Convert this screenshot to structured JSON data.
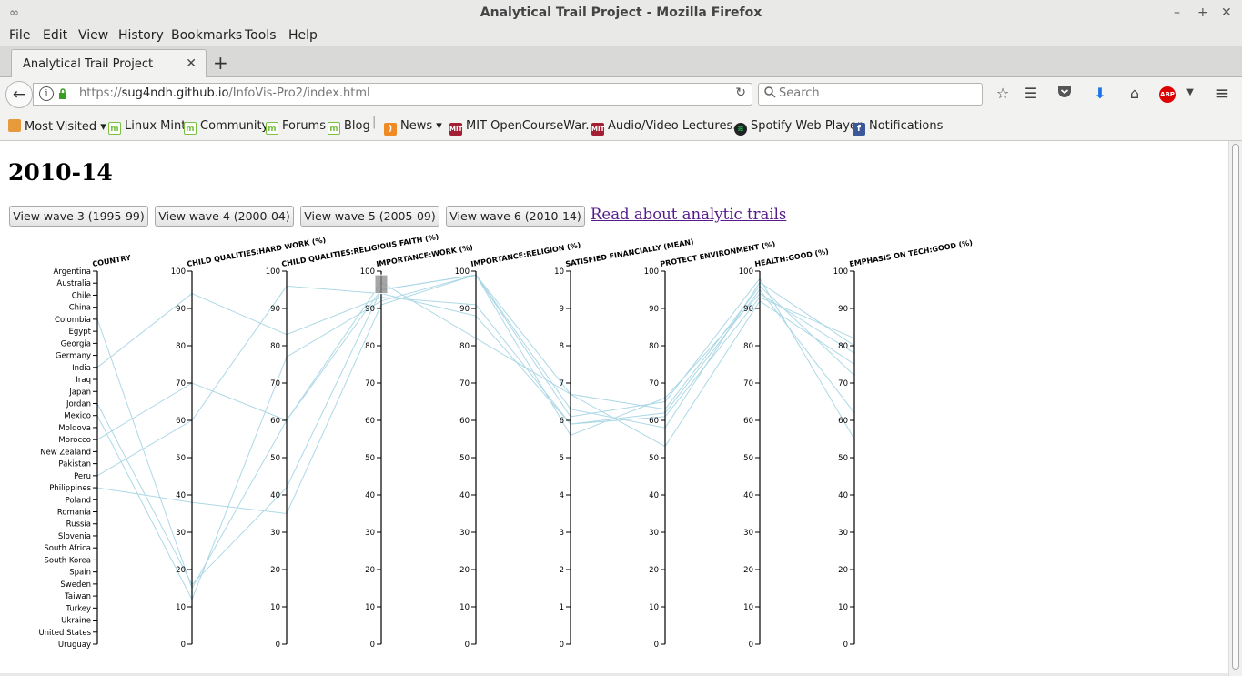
{
  "window": {
    "title": "Analytical Trail Project - Mozilla Firefox",
    "controls": [
      "–",
      "+",
      "✕"
    ]
  },
  "menu": [
    "File",
    "Edit",
    "View",
    "History",
    "Bookmarks",
    "Tools",
    "Help"
  ],
  "tab": {
    "label": "Analytical Trail Project",
    "close": "✕",
    "new": "+"
  },
  "urlbar": {
    "url_prefix": "https://",
    "url_host": "sug4ndh.github.io",
    "url_path": "/InfoVis-Pro2/index.html",
    "search_placeholder": "Search"
  },
  "icons": {
    "back": "←",
    "info": "i",
    "lock": "🔒",
    "reload": "↻",
    "search": "🔍",
    "star": "☆",
    "reader": "☰",
    "pocket": "◡",
    "download": "⬇",
    "home": "⌂",
    "abp": "ABP",
    "menu": "≡"
  },
  "bookmarks": [
    {
      "label": "Most Visited",
      "icon": "folder",
      "dropdown": true
    },
    {
      "label": "Linux Mint",
      "icon": "mint"
    },
    {
      "label": "Community",
      "icon": "mint"
    },
    {
      "label": "Forums",
      "icon": "mint"
    },
    {
      "label": "Blog",
      "icon": "mint"
    },
    {
      "label": "News",
      "icon": "rss",
      "dropdown": true
    },
    {
      "label": "MIT OpenCourseWar...",
      "icon": "mit"
    },
    {
      "label": "Audio/Video Lectures...",
      "icon": "mit"
    },
    {
      "label": "Spotify Web Player",
      "icon": "spotify"
    },
    {
      "label": "Notifications",
      "icon": "facebook"
    }
  ],
  "page": {
    "heading": "2010-14",
    "buttons": [
      "View wave 3 (1995-99)",
      "View wave 4 (2000-04)",
      "View wave 5 (2005-09)",
      "View wave 6 (2010-14)"
    ],
    "link": "Read about analytic trails"
  },
  "chart_data": {
    "type": "parallel-coordinates",
    "line_color": "#add8e6",
    "axes": [
      {
        "label": "COUNTRY",
        "type": "categorical",
        "categories": [
          "Argentina",
          "Australia",
          "Chile",
          "China",
          "Colombia",
          "Egypt",
          "Georgia",
          "Germany",
          "India",
          "Iraq",
          "Japan",
          "Jordan",
          "Mexico",
          "Moldova",
          "Morocco",
          "New Zealand",
          "Pakistan",
          "Peru",
          "Philippines",
          "Poland",
          "Romania",
          "Russia",
          "Slovenia",
          "South Africa",
          "South Korea",
          "Spain",
          "Sweden",
          "Taiwan",
          "Turkey",
          "Ukraine",
          "United States",
          "Uruguay"
        ]
      },
      {
        "label": "CHILD QUALITIES:HARD WORK (%)",
        "domain": [
          0,
          100
        ],
        "ticks": [
          0,
          10,
          20,
          30,
          40,
          50,
          60,
          70,
          80,
          90,
          100
        ]
      },
      {
        "label": "CHILD QUALITIES:RELIGIOUS FAITH (%)",
        "domain": [
          0,
          100
        ],
        "ticks": [
          0,
          10,
          20,
          30,
          40,
          50,
          60,
          70,
          80,
          90,
          100
        ]
      },
      {
        "label": "IMPORTANCE:WORK (%)",
        "domain": [
          0,
          100
        ],
        "ticks": [
          0,
          10,
          20,
          30,
          40,
          50,
          60,
          70,
          80,
          90,
          100
        ],
        "brush": [
          94,
          99
        ]
      },
      {
        "label": "IMPORTANCE:RELIGION (%)",
        "domain": [
          0,
          100
        ],
        "ticks": [
          0,
          10,
          20,
          30,
          40,
          50,
          60,
          70,
          80,
          90,
          100
        ]
      },
      {
        "label": "SATISFIED FINANCIALLY (MEAN)",
        "domain": [
          0,
          10
        ],
        "ticks": [
          0,
          1,
          2,
          3,
          4,
          5,
          6,
          7,
          8,
          9,
          10
        ]
      },
      {
        "label": "PROTECT ENVIRONMENT (%)",
        "domain": [
          0,
          100
        ],
        "ticks": [
          0,
          10,
          20,
          30,
          40,
          50,
          60,
          70,
          80,
          90,
          100
        ]
      },
      {
        "label": "HEALTH:GOOD (%)",
        "domain": [
          0,
          100
        ],
        "ticks": [
          0,
          10,
          20,
          30,
          40,
          50,
          60,
          70,
          80,
          90,
          100
        ]
      },
      {
        "label": "EMPHASIS ON TECH:GOOD (%)",
        "domain": [
          0,
          100
        ],
        "ticks": [
          0,
          10,
          20,
          30,
          40,
          50,
          60,
          70,
          80,
          90,
          100
        ]
      }
    ],
    "records": [
      {
        "country": "Colombia",
        "values": [
          15,
          60,
          95,
          99,
          6.1,
          65,
          98,
          55
        ]
      },
      {
        "country": "India",
        "values": [
          94,
          83,
          93,
          91,
          5.9,
          62,
          95,
          62
        ]
      },
      {
        "country": "Mexico",
        "values": [
          12,
          77,
          92,
          99,
          6.3,
          58,
          97,
          80
        ]
      },
      {
        "country": "Morocco",
        "values": [
          70,
          60,
          97,
          82,
          6.7,
          63,
          96,
          72
        ]
      },
      {
        "country": "Peru",
        "values": [
          60,
          96,
          94,
          88,
          5.9,
          61,
          93,
          82
        ]
      },
      {
        "country": "Philippines",
        "values": [
          38,
          35,
          91,
          99,
          6.7,
          53,
          92,
          75
        ]
      },
      {
        "country": "Jordan",
        "values": [
          16,
          42,
          95,
          99,
          5.6,
          66,
          94,
          78
        ]
      }
    ]
  }
}
